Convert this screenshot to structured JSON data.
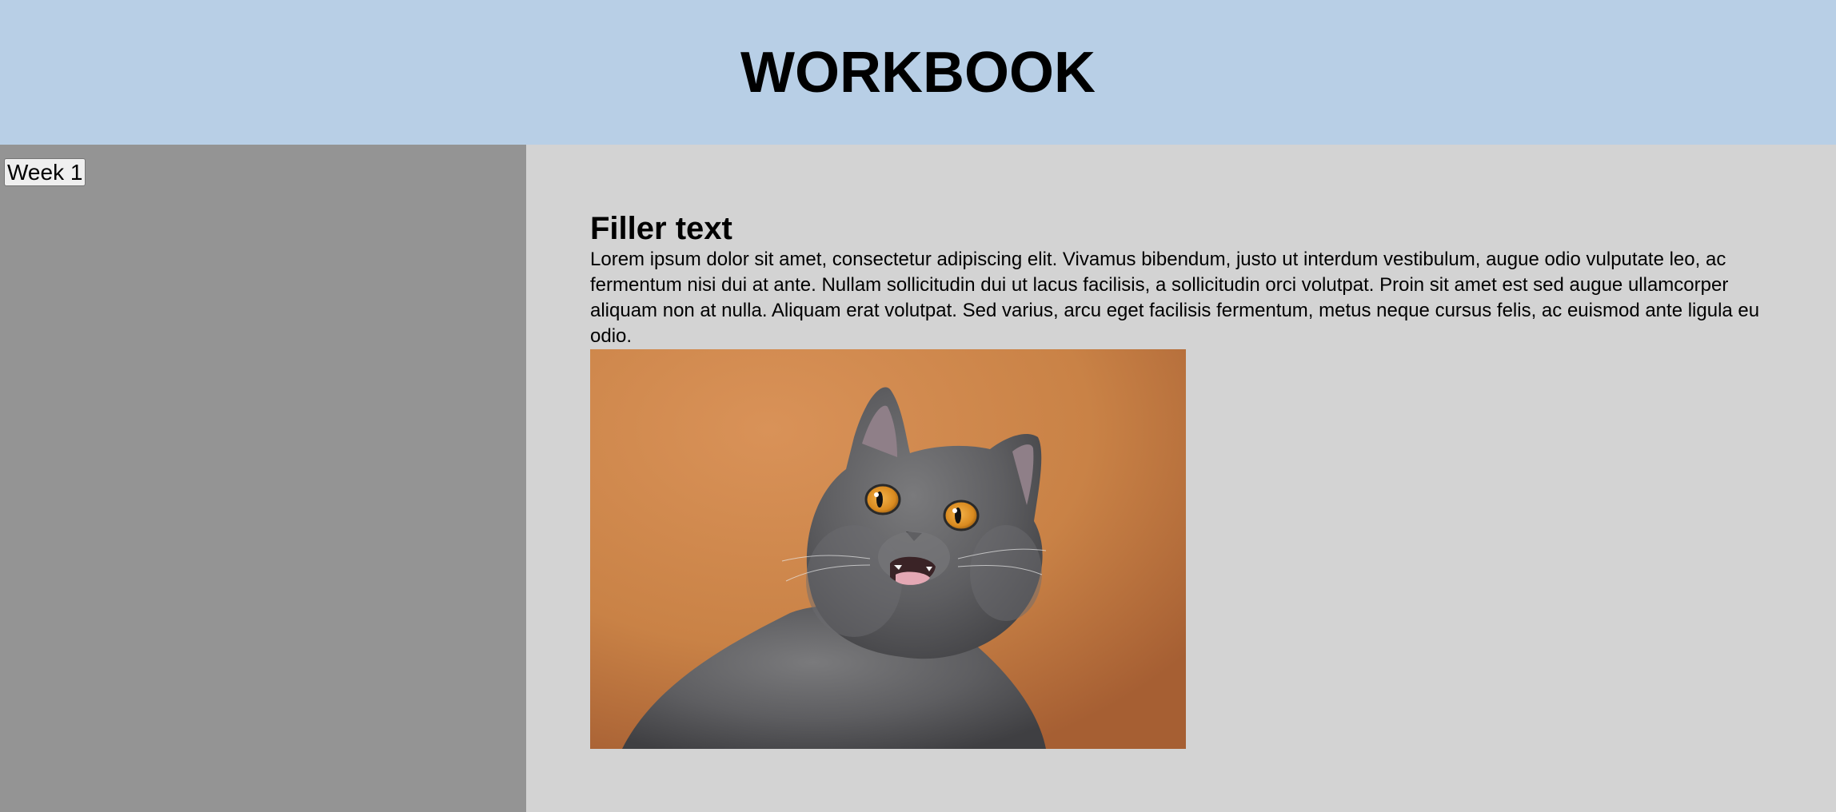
{
  "header": {
    "title": "WORKBOOK"
  },
  "sidebar": {
    "buttons": [
      {
        "label": "Week 1"
      }
    ]
  },
  "main": {
    "heading": "Filler text",
    "paragraph": "Lorem ipsum dolor sit amet, consectetur adipiscing elit. Vivamus bibendum, justo ut interdum vestibulum, augue odio vulputate leo, ac fermentum nisi dui at ante. Nullam sollicitudin dui ut lacus facilisis, a sollicitudin orci volutpat. Proin sit amet est sed augue ullamcorper aliquam non at nulla. Aliquam erat volutpat. Sed varius, arcu eget facilisis fermentum, metus neque cursus felis, ac euismod ante ligula eu odio.",
    "image": {
      "subject": "grey-cat-photo"
    }
  },
  "colors": {
    "header_bg": "#b8cfe6",
    "sidebar_bg": "#949494",
    "main_bg": "#d3d3d3",
    "photo_bg": "#c9834a"
  }
}
